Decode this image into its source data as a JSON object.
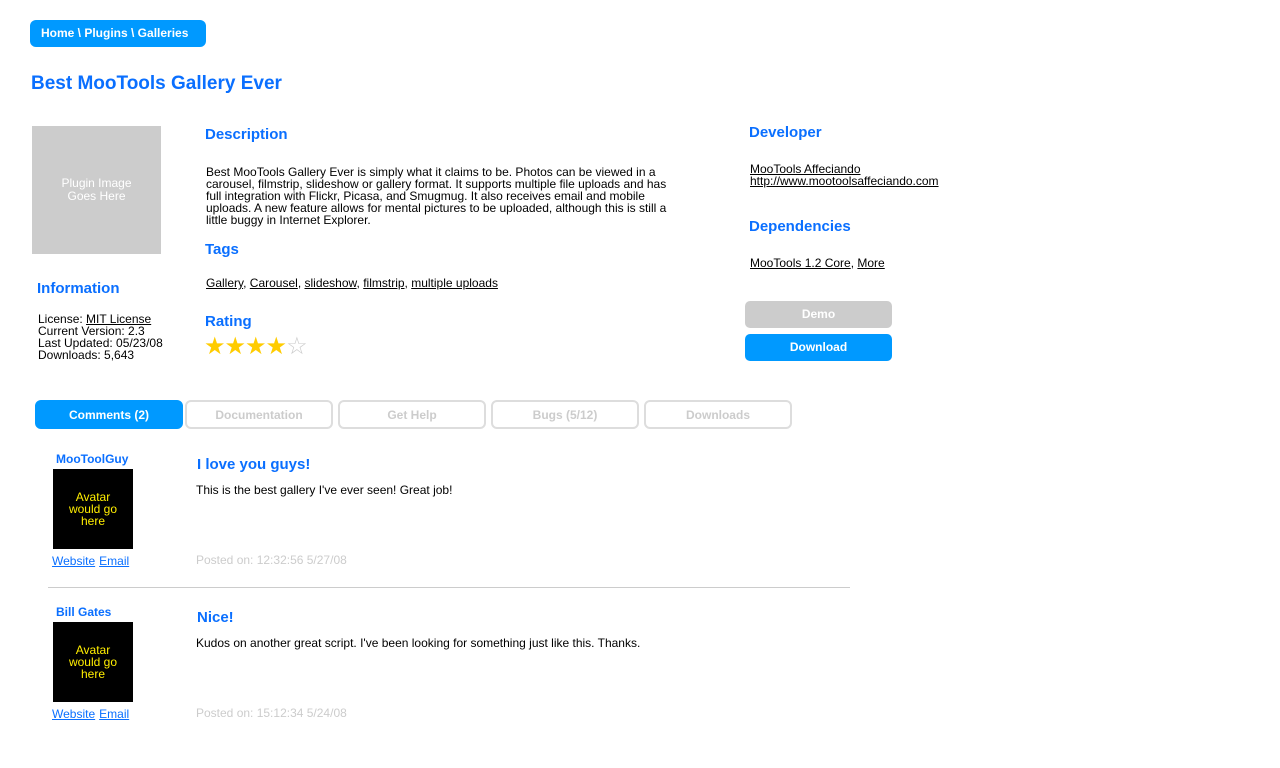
{
  "breadcrumb": "Home \\ Plugins \\ Galleries",
  "title": "Best MooTools Gallery Ever",
  "image_placeholder": "Plugin Image Goes Here",
  "information": {
    "heading": "Information",
    "license_label": "License: ",
    "license_link": "MIT License",
    "version": "Current Version: 2.3",
    "updated": "Last Updated: 05/23/08",
    "downloads": "Downloads: 5,643"
  },
  "description": {
    "heading": "Description",
    "text": "Best MooTools Gallery Ever is simply what it claims to be. Photos can be viewed in a carousel, filmstrip, slideshow or gallery format. It supports multiple file uploads and has full integration with Flickr, Picasa, and Smugmug. It also receives email and mobile uploads. A new feature allows for mental pictures to be uploaded, although this is still a little buggy in Internet Explorer."
  },
  "tags": {
    "heading": "Tags",
    "items": [
      "Gallery",
      "Carousel",
      "slideshow",
      "filmstrip",
      "multiple uploads"
    ]
  },
  "rating": {
    "heading": "Rating",
    "value": 4,
    "max": 5,
    "color": "#ffcc00"
  },
  "developer": {
    "heading": "Developer",
    "name": "MooTools Affeciando",
    "url": "http://www.mootoolsaffeciando.com"
  },
  "dependencies": {
    "heading": "Dependencies",
    "items": [
      "MooTools 1.2 Core",
      "More"
    ]
  },
  "buttons": {
    "demo": "Demo",
    "download": "Download"
  },
  "tabs": [
    {
      "label": "Comments (2)",
      "active": true
    },
    {
      "label": "Documentation",
      "active": false
    },
    {
      "label": "Get Help",
      "active": false
    },
    {
      "label": "Bugs (5/12)",
      "active": false
    },
    {
      "label": "Downloads",
      "active": false
    }
  ],
  "comments": [
    {
      "author": "MooToolGuy",
      "avatar": "Avatar would go here",
      "website": "Website",
      "email": "Email",
      "title": "I love you guys!",
      "body": "This is the best gallery I've ever seen! Great job!",
      "posted": "Posted on: 12:32:56 5/27/08"
    },
    {
      "author": "Bill Gates",
      "avatar": "Avatar would go here",
      "website": "Website",
      "email": "Email",
      "title": "Nice!",
      "body": "Kudos on another great script. I've been looking for something just like this. Thanks.",
      "posted": "Posted on: 15:12:34 5/24/08"
    }
  ],
  "colors": {
    "accent": "#0099ff",
    "heading": "#0a6fff",
    "muted": "#cccccc"
  }
}
